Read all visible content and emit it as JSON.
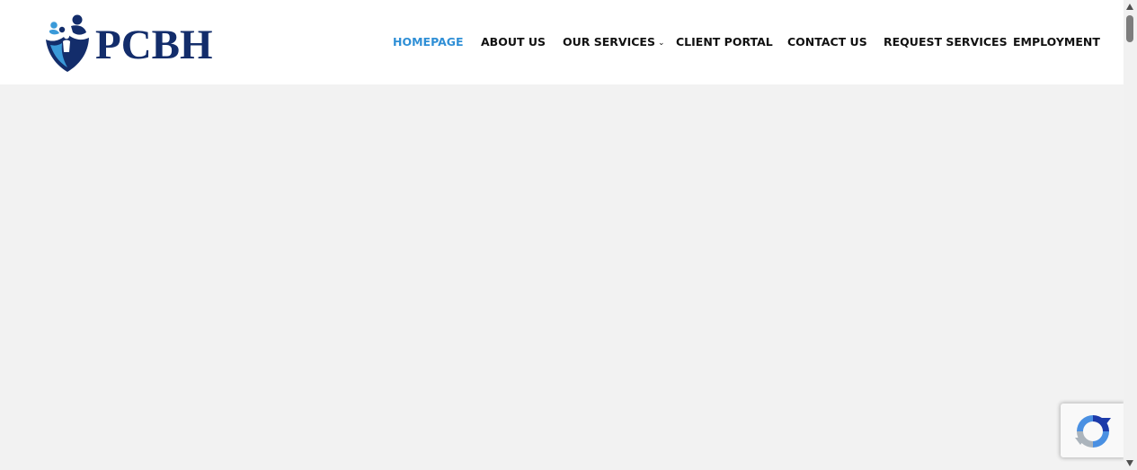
{
  "logo": {
    "text": "PCBH",
    "icon": "family-shield-icon"
  },
  "colors": {
    "brand_navy": "#132d6b",
    "brand_light_blue": "#3a9ad9",
    "nav_active": "#2f8fd6",
    "nav_text": "#111111",
    "content_bg": "#f2f2f2",
    "header_bg": "#ffffff"
  },
  "nav": {
    "items": [
      {
        "label": "HOMEPAGE",
        "active": true
      },
      {
        "label": "ABOUT US"
      },
      {
        "label": "OUR SERVICES",
        "has_dropdown": true,
        "dropdown_icon": "chevron-down-icon"
      },
      {
        "label": "CLIENT PORTAL"
      },
      {
        "label": "CONTACT US"
      },
      {
        "label": "REQUEST SERVICES"
      },
      {
        "label": "EMPLOYMENT"
      }
    ]
  },
  "recaptcha": {
    "icon": "recaptcha-logo-icon"
  },
  "scrollbar": {
    "up_icon": "scroll-up-arrow-icon",
    "down_icon": "scroll-down-arrow-icon"
  }
}
